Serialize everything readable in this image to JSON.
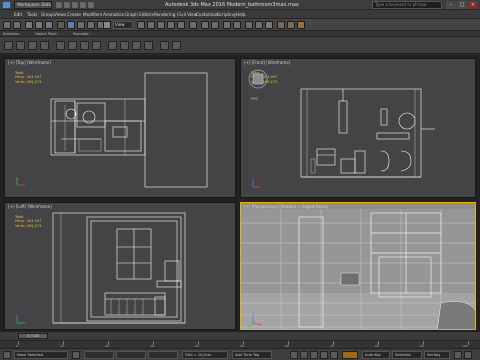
{
  "window": {
    "workspace_label": "Workspace: Default",
    "title": "Autodesk 3ds Max 2016    Modern_bathroom3max.max",
    "search_placeholder": "Type a keyword or phrase"
  },
  "menu": [
    "Edit",
    "Tools",
    "Group",
    "Views",
    "Create",
    "Modifiers",
    "Animation",
    "Graph Editors",
    "Rendering",
    "Civil View",
    "Customize",
    "Scripting",
    "Help"
  ],
  "toolbar": {
    "view_dropdown": "View"
  },
  "ribbon": {
    "labels": [
      "Selection",
      "Object Paint",
      "Populate"
    ]
  },
  "viewports": {
    "top": {
      "label": "[+] [Top] [Wireframe]",
      "stats": "Total\nPolys: 403,997\nVerts: 409,273"
    },
    "front": {
      "label": "[+] [Front] [Wireframe]",
      "stats": "Total\nPolys: 403,997\nVerts: 409,273",
      "fps": "FPS:"
    },
    "left": {
      "label": "[+] [Left] [Wireframe]",
      "stats": "Total\nPolys: 403,997\nVerts: 409,273"
    },
    "perspective": {
      "label": "[+] [Perspective] [Shaded + Edged Faces]"
    }
  },
  "timeslider": {
    "value": "0 / 100"
  },
  "trackbar": {
    "ticks": [
      "0",
      "10",
      "20",
      "30",
      "40",
      "50",
      "60",
      "70",
      "80",
      "90",
      "100"
    ]
  },
  "status": {
    "selection": "None Selected",
    "grid": "Grid = 10,0cm",
    "add_time_tag": "Add Time Tag",
    "auto_key": "Auto Key",
    "set_key": "Set Key",
    "key_filters": "Key Filters...",
    "selected": "Selected"
  },
  "colors": {
    "active_border": "#e8b400",
    "wire": "#ffffff",
    "stats": "#e6c23c",
    "viewport_bg": "#444447"
  }
}
